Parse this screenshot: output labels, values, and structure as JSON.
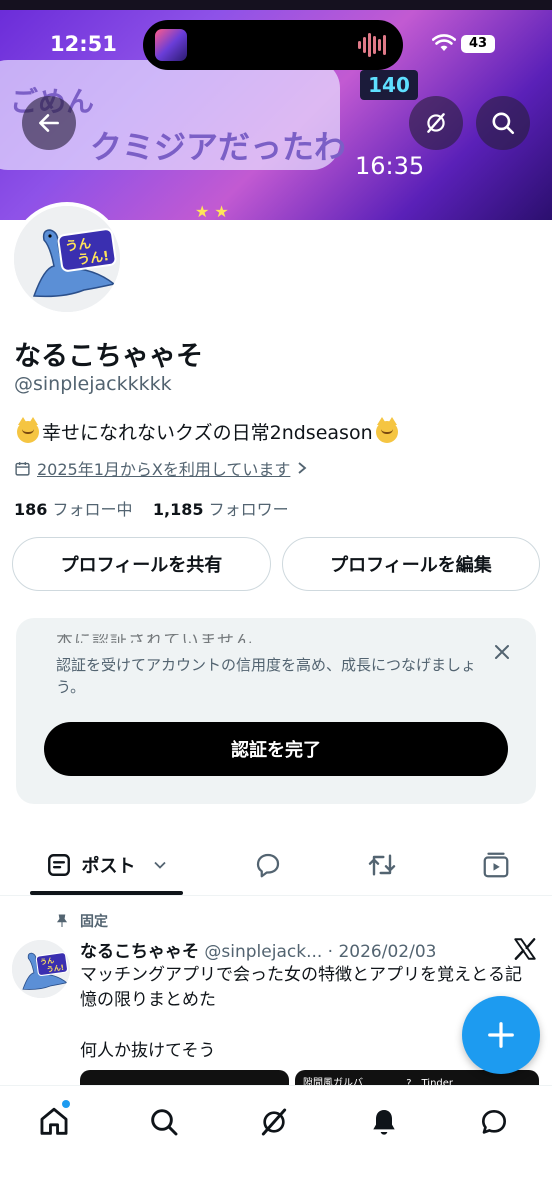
{
  "status_bar": {
    "time": "12:51",
    "battery": "43"
  },
  "banner": {
    "bubble_line1": "ごめん",
    "bubble_line2": "クミジアだったわ",
    "scoreboard": "140",
    "time_in_image": "16:35"
  },
  "profile": {
    "display_name": "なるこちゃゃそ",
    "handle": "@sinplejackkkkk",
    "bio": "幸せになれないクズの日常2ndseason",
    "joined": "2025年1月からXを利用しています",
    "following_count": "186",
    "following_label": "フォロー中",
    "followers_count": "1,185",
    "followers_label": "フォロワー",
    "avatar_sticker": "うん うん!"
  },
  "buttons": {
    "share_label": "プロフィールを共有",
    "edit_label": "プロフィールを編集"
  },
  "verify_card": {
    "cut_title": "本に認証されていません",
    "description": "認証を受けてアカウントの信用度を高め、成長につなげましょう。",
    "button_label": "認証を完了"
  },
  "tabs": {
    "posts_label": "ポスト"
  },
  "pinned_post": {
    "pinned_label": "固定",
    "author": "なるこちゃゃそ",
    "handle_date": "@sinplejack... · 2026/02/03",
    "text": "マッチングアプリで会った女の特徴とアプリを覚えとる記憶の限りまとめた",
    "text2": "何人か抜けてそう",
    "media2_left": "隙間風ガルバ",
    "media2_right": "?　Tinder"
  },
  "colors": {
    "accent": "#1d9bf0",
    "text_primary": "#0f1419",
    "text_secondary": "#536471"
  }
}
